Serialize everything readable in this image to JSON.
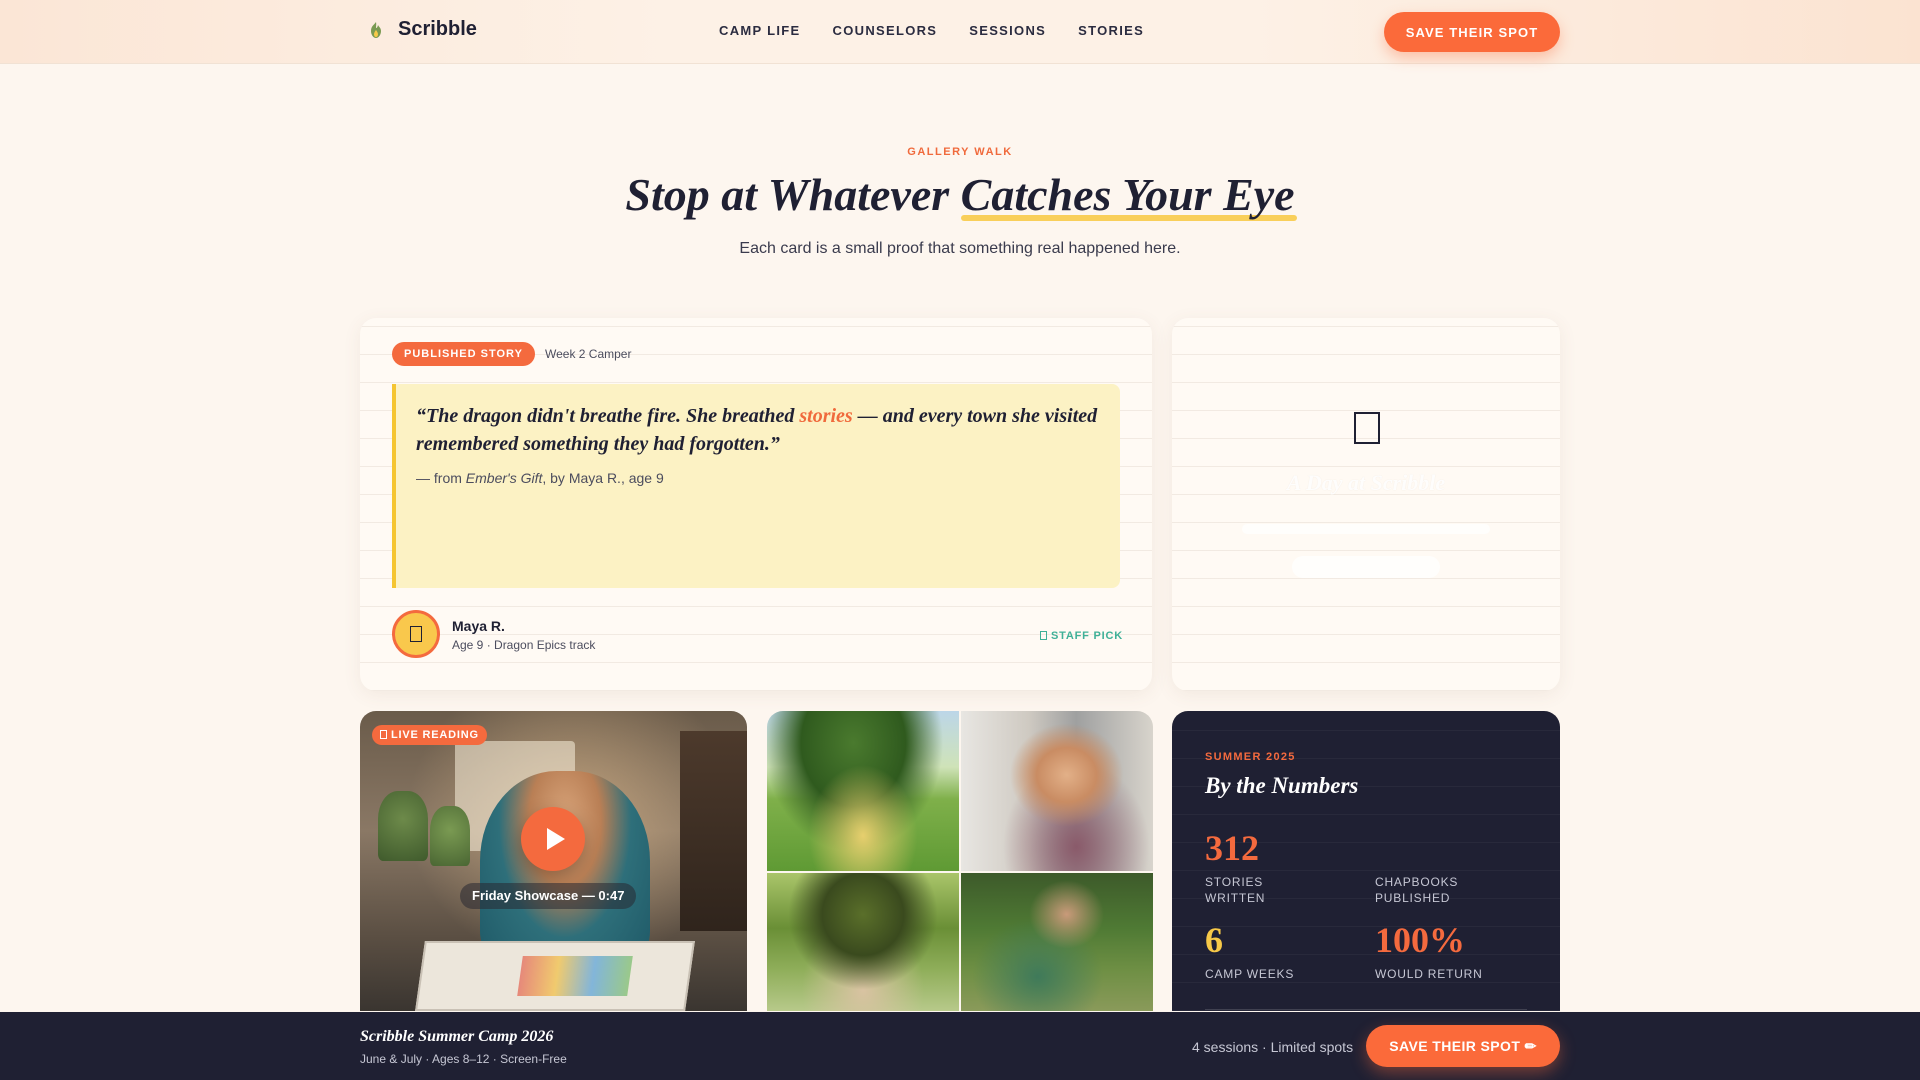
{
  "nav": {
    "brand": "Scribble",
    "links": [
      "CAMP LIFE",
      "COUNSELORS",
      "SESSIONS",
      "STORIES"
    ],
    "cta": "SAVE THEIR SPOT"
  },
  "header": {
    "eyebrow": "GALLERY WALK",
    "title_start": "Stop at Whatever ",
    "title_highlight": "Catches Your Eye",
    "subtitle": "Each card is a small proof that something real happened here."
  },
  "story_card": {
    "badge": "PUBLISHED STORY",
    "week": "Week 2 Camper",
    "quote_before": "“The dragon didn't breathe fire. She breathed ",
    "quote_highlight": "stories",
    "quote_after": " — and every town she visited remembered something they had forgotten.”",
    "source_prefix": "— from ",
    "source_title": "Ember's Gift",
    "source_suffix": ", by Maya R., age 9",
    "author_name": "Maya R.",
    "author_meta": "Age 9 · Dragon Epics track",
    "staff_pick": "STAFF PICK"
  },
  "day_card": {
    "title": "A Day at Scribble"
  },
  "live_card": {
    "badge": "LIVE READING",
    "caption": "Friday Showcase — 0:47"
  },
  "numbers_card": {
    "eyebrow": "SUMMER 2025",
    "title": "By the Numbers",
    "stats": [
      {
        "value": "312",
        "label": "STORIES WRITTEN",
        "color": "#f46a3e"
      },
      {
        "value": "",
        "label": "CHAPBOOKS PUBLISHED",
        "color": "#f46a3e"
      },
      {
        "value": "6",
        "label": "CAMP WEEKS",
        "color": "#f7c948"
      },
      {
        "value": "100%",
        "label": "WOULD RETURN",
        "color": "#f46a3e"
      }
    ]
  },
  "footer": {
    "title": "Scribble Summer Camp 2026",
    "subtitle": "June & July · Ages 8–12 · Screen-Free",
    "spots": "4 sessions · Limited spots",
    "cta": "SAVE THEIR SPOT ✏"
  },
  "colors": {
    "accent": "#fb6a3a",
    "navy": "#1f2033",
    "yellow": "#f7c948",
    "teal": "#3fb097",
    "page_bg": "#fdf6ef"
  }
}
